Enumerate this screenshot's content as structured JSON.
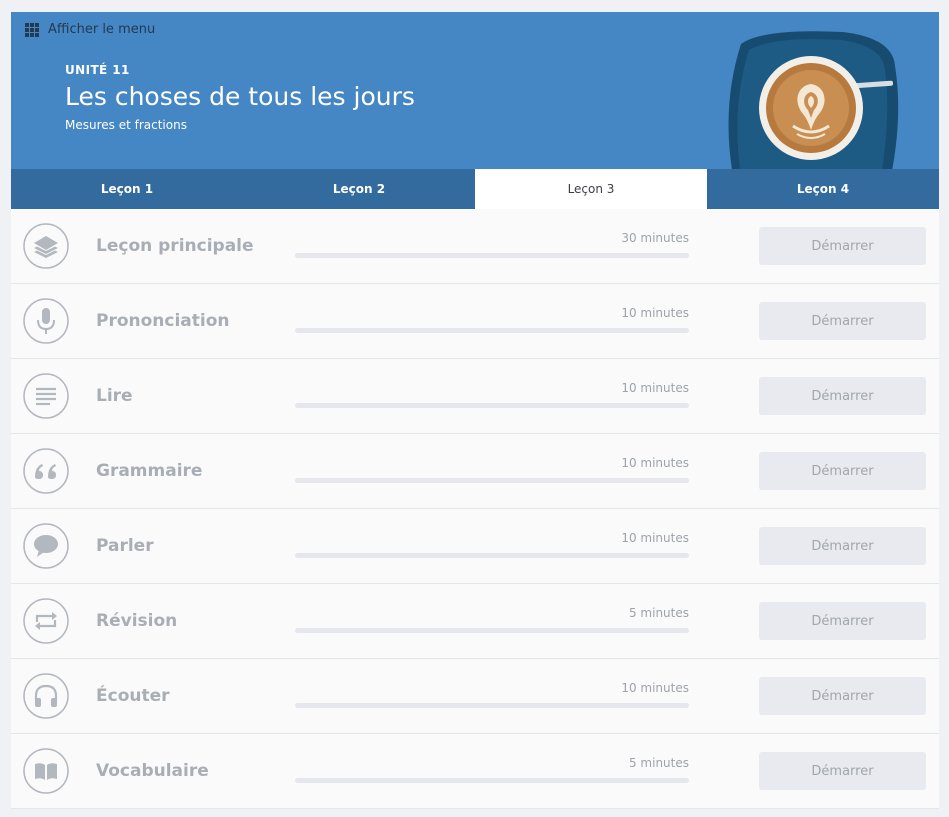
{
  "header": {
    "menu_label": "Afficher le menu",
    "unit": "UNITÉ 11",
    "title": "Les choses de tous les jours",
    "subtitle": "Mesures et fractions",
    "accent": "#4587c4"
  },
  "tabs": [
    {
      "label": "Leçon 1",
      "active": false
    },
    {
      "label": "Leçon 2",
      "active": false
    },
    {
      "label": "Leçon 3",
      "active": true
    },
    {
      "label": "Leçon 4",
      "active": false
    }
  ],
  "activities": [
    {
      "name": "Leçon principale",
      "duration": "30 minutes",
      "progress": 0,
      "button": "Démarrer",
      "icon": "layers-icon"
    },
    {
      "name": "Prononciation",
      "duration": "10 minutes",
      "progress": 0,
      "button": "Démarrer",
      "icon": "microphone-icon"
    },
    {
      "name": "Lire",
      "duration": "10 minutes",
      "progress": 0,
      "button": "Démarrer",
      "icon": "text-lines-icon"
    },
    {
      "name": "Grammaire",
      "duration": "10 minutes",
      "progress": 0,
      "button": "Démarrer",
      "icon": "quote-icon"
    },
    {
      "name": "Parler",
      "duration": "10 minutes",
      "progress": 0,
      "button": "Démarrer",
      "icon": "speech-bubble-icon"
    },
    {
      "name": "Révision",
      "duration": "5 minutes",
      "progress": 0,
      "button": "Démarrer",
      "icon": "repeat-icon"
    },
    {
      "name": "Écouter",
      "duration": "10 minutes",
      "progress": 0,
      "button": "Démarrer",
      "icon": "headphones-icon"
    },
    {
      "name": "Vocabulaire",
      "duration": "5 minutes",
      "progress": 0,
      "button": "Démarrer",
      "icon": "book-icon"
    }
  ]
}
